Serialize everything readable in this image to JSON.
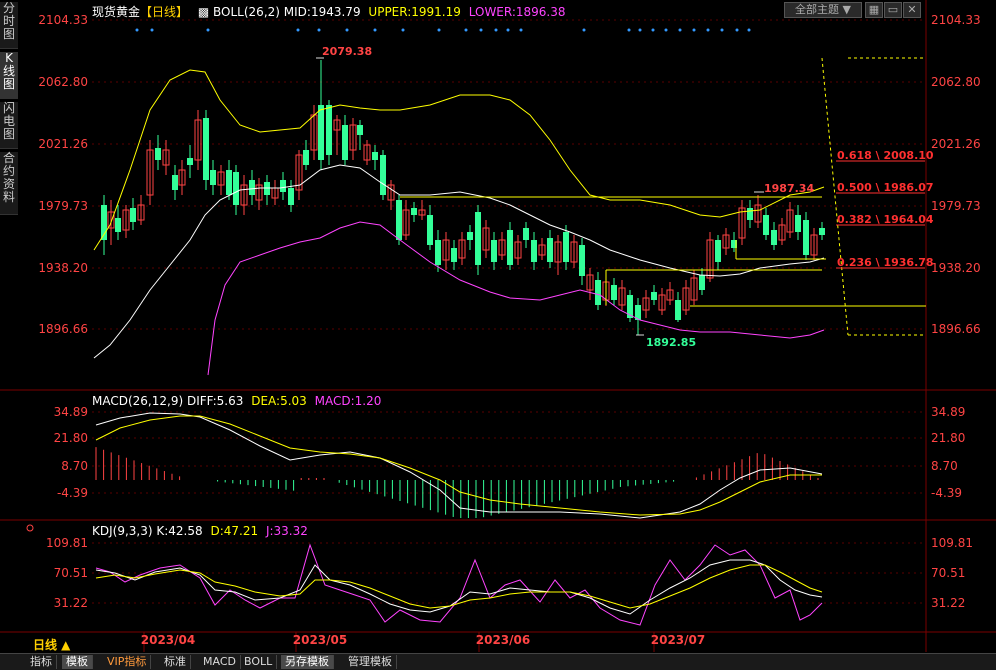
{
  "sidebar": {
    "tabs": [
      {
        "label": "分时图",
        "active": false
      },
      {
        "label": "K线图",
        "active": true
      },
      {
        "label": "闪电图",
        "active": false
      },
      {
        "label": "合约资料",
        "active": false
      }
    ]
  },
  "header": {
    "symbol": "现货黄金",
    "period_tag": "【日线】",
    "boll": "BOLL(26,2)",
    "mid": "MID:1943.79",
    "upper": "UPPER:1991.19",
    "lower": "LOWER:1896.38",
    "theme_select": "全部主题",
    "colors": {
      "mid": "#ffffff",
      "upper": "#ffff00",
      "lower": "#ff44ff",
      "up": "#ff4444",
      "down": "#33ff99"
    }
  },
  "price_axis": [
    "2104.33",
    "2062.80",
    "2021.26",
    "1979.73",
    "1938.20",
    "1896.66"
  ],
  "annotations": {
    "high_label": "2079.38",
    "low_label": "1892.85",
    "recent_high": "1987.34",
    "fib": [
      "0.618 \\ 2008.10",
      "0.500 \\ 1986.07",
      "0.382 \\ 1964.04",
      "0.236 \\ 1936.78"
    ]
  },
  "macd": {
    "title": "MACD(26,12,9)",
    "diff": "DIFF:5.63",
    "dea": "DEA:5.03",
    "macd": "MACD:1.20",
    "axis": [
      "34.89",
      "21.80",
      "8.70",
      "-4.39"
    ]
  },
  "kdj": {
    "title": "KDJ(9,3,3)",
    "k": "K:42.58",
    "d": "D:47.21",
    "j": "J:33.32",
    "axis": [
      "109.81",
      "70.51",
      "31.22"
    ]
  },
  "time_axis": [
    "2023/04",
    "2023/05",
    "2023/06",
    "2023/07"
  ],
  "period_label": "日线 ▲",
  "bottom_tabs": [
    {
      "label": "指标",
      "active": false
    },
    {
      "label": "模板",
      "active": true
    },
    {
      "label": "VIP指标",
      "active": false,
      "vip": true
    },
    {
      "label": "标准",
      "active": false
    },
    {
      "label": "MACD",
      "active": false
    },
    {
      "label": "BOLL",
      "active": false
    },
    {
      "label": "另存模板",
      "active": true
    },
    {
      "label": "管理模板",
      "active": false
    }
  ]
}
